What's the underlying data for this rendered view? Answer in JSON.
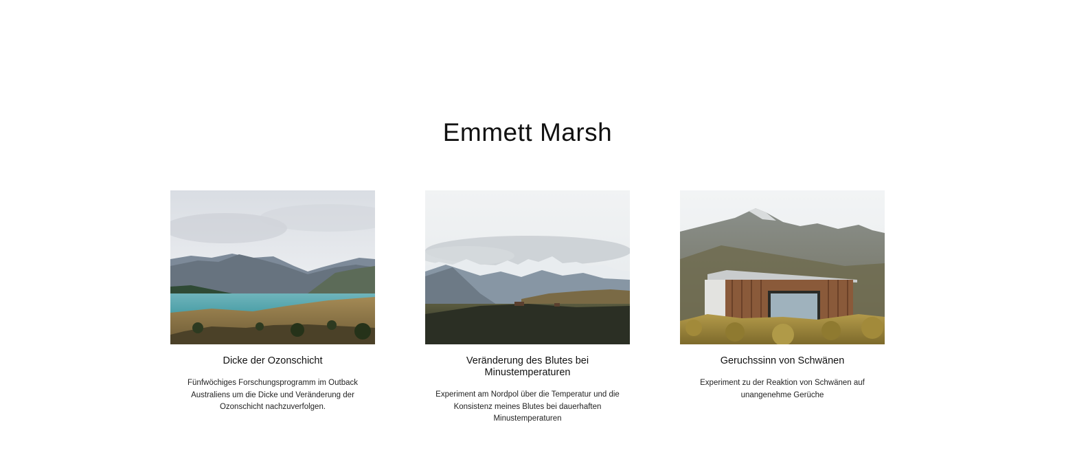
{
  "page": {
    "title": "Emmett Marsh"
  },
  "cards": [
    {
      "image_icon": "lake-mountain-landscape-photo",
      "title": "Dicke der Ozonschicht",
      "description": "Fünfwöchiges Forschungsprogramm im Outback Australiens um die Dicke und Veränderung der Ozonschicht nachzuverfolgen."
    },
    {
      "image_icon": "snowy-mountain-valley-photo",
      "title": "Veränderung des Blutes bei Minustemperaturen",
      "description": "Experiment am Nordpol über die Temperatur und die Konsistenz meines Blutes bei dauerhaften Minustemperaturen"
    },
    {
      "image_icon": "wooden-cabin-mountain-photo",
      "title": "Geruchssinn von Schwänen",
      "description": "Experiment zu der Reaktion von Schwänen auf unangenehme Gerüche"
    }
  ],
  "colors": {
    "background": "#ffffff",
    "text": "#111111"
  }
}
